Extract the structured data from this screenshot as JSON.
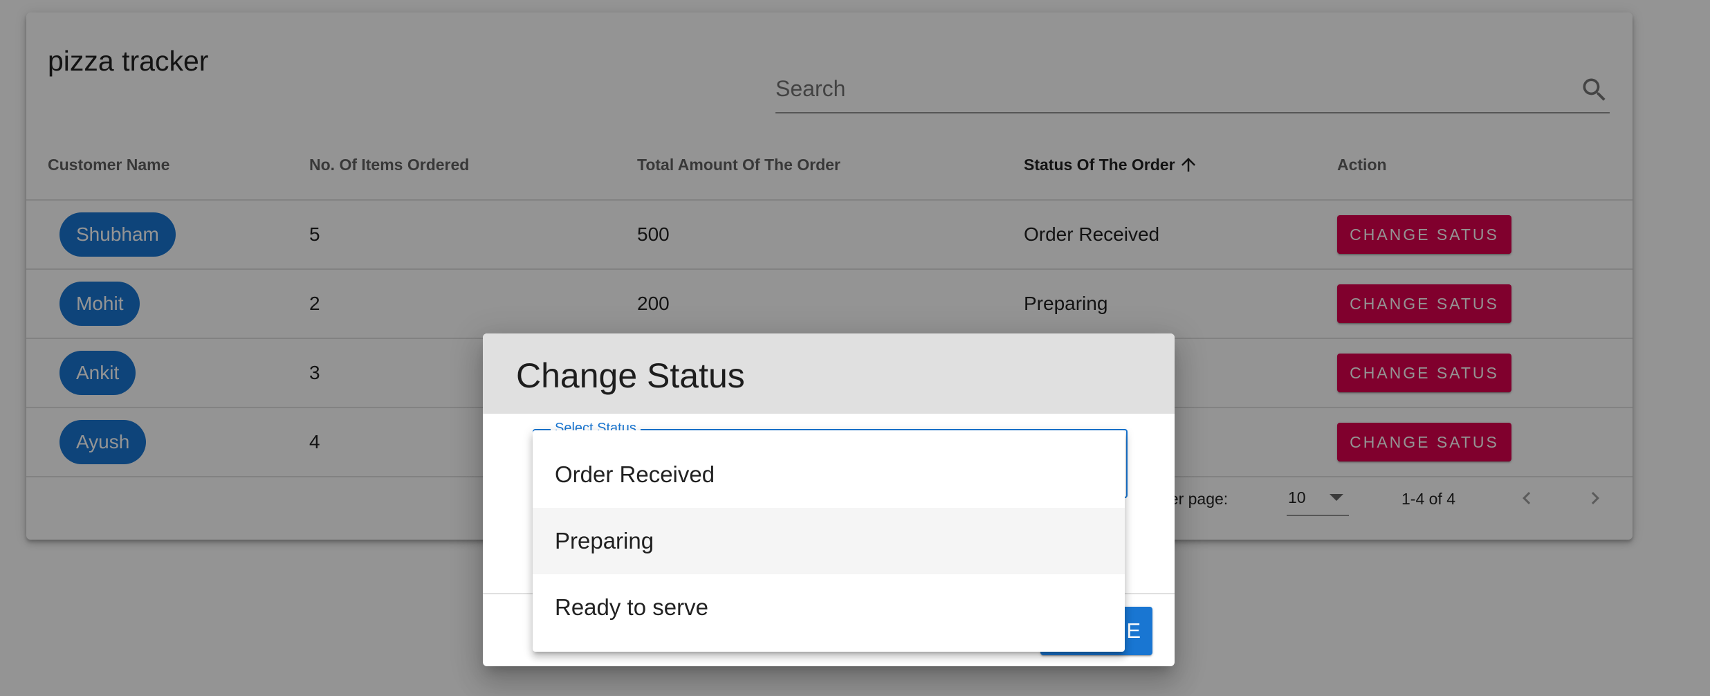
{
  "app": {
    "title": "pizza tracker"
  },
  "search": {
    "placeholder": "Search"
  },
  "table": {
    "headers": [
      "Customer Name",
      "No. Of Items Ordered",
      "Total Amount Of The Order",
      "Status Of The Order",
      "Action"
    ],
    "sorted_column": "Status Of The Order",
    "sort_direction": "ascending",
    "rows": [
      {
        "customer": "Shubham",
        "items": "5",
        "amount": "500",
        "status": "Order Received",
        "action": "CHANGE SATUS"
      },
      {
        "customer": "Mohit",
        "items": "2",
        "amount": "200",
        "status": "Preparing",
        "action": "CHANGE SATUS"
      },
      {
        "customer": "Ankit",
        "items": "3",
        "amount": "",
        "status": "",
        "action": "CHANGE SATUS"
      },
      {
        "customer": "Ayush",
        "items": "4",
        "amount": "",
        "status": "",
        "action": "CHANGE SATUS"
      }
    ]
  },
  "pagination": {
    "rows_per_page_label": "per page:",
    "rows_per_page_value": "10",
    "range": "1-4 of 4"
  },
  "dialog": {
    "title": "Change Status",
    "select_label": "Select Status",
    "button_label": "E"
  },
  "dropdown": {
    "options": [
      "Order Received",
      "Preparing",
      "Ready to serve"
    ],
    "hovered": "Preparing"
  },
  "colors": {
    "primary": "#1976d2",
    "secondary": "#dc004e",
    "backdrop": "rgba(0,0,0,0.42)"
  },
  "icons": [
    "search-icon",
    "arrow-upward-icon",
    "chevron-left-icon",
    "chevron-right-icon",
    "arrow-drop-down-icon"
  ]
}
